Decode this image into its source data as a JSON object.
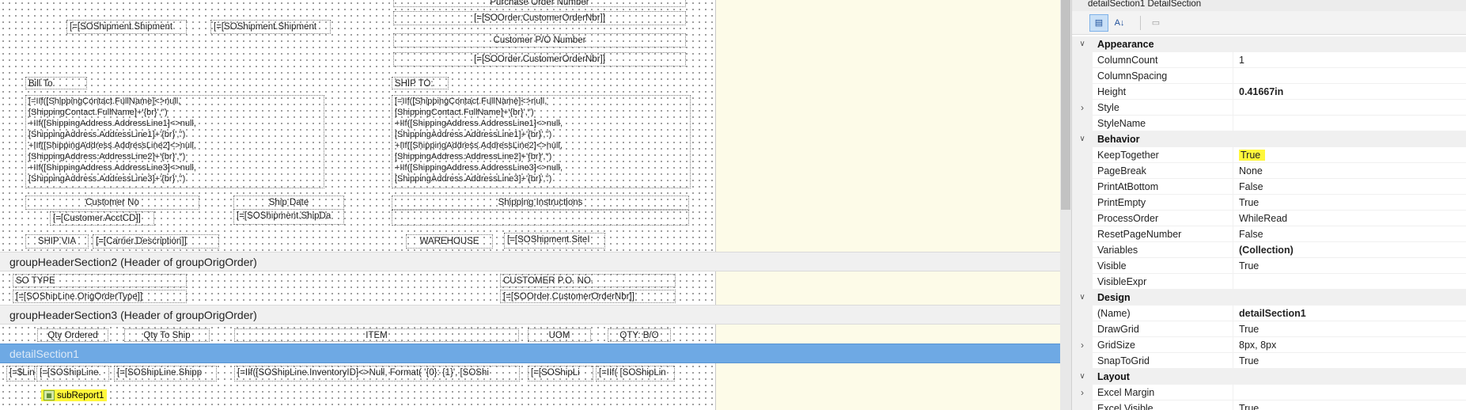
{
  "designer": {
    "page_header": {
      "purchase_order_number": "Purchase Order Number",
      "customer_order_nbr_1": "[=[SOOrder.CustomerOrderNbr]]",
      "customer_po_number": "Customer P/O Number",
      "customer_order_nbr_2": "[=[SOOrder.CustomerOrderNbr]]",
      "shipment_1": "[=[SOShipment.Shipment",
      "shipment_2": "[=[SOShipment.Shipment",
      "bill_to": "Bill To",
      "ship_to": "SHIP TO:",
      "bill_to_expr": "[=IIf([ShippingContact.FullName]<>null,\n[ShippingContact.FullName]+'{br}','')\n+IIf([ShippingAddress.AddressLine1]<>null,\n[ShippingAddress.AddressLine1]+'{br}','')\n+IIf([ShippingAddress.AddressLine2]<>null,\n[ShippingAddress.AddressLine2]+'{br}','')\n+IIf([ShippingAddress.AddressLine3]<>null,\n[ShippingAddress.AddressLine3]+'{br}','')",
      "ship_to_expr": "[=IIf([ShippingContact.FullName]<>null,\n[ShippingContact.FullName]+'{br}','')\n+IIf([ShippingAddress.AddressLine1]<>null,\n[ShippingAddress.AddressLine1]+'{br}','')\n+IIf([ShippingAddress.AddressLine2]<>null,\n[ShippingAddress.AddressLine2]+'{br}','')\n+IIf([ShippingAddress.AddressLine3]<>null,\n[ShippingAddress.AddressLine3]+'{br}','')",
      "customer_no": "Customer No",
      "ship_date": "Ship Date",
      "shipping_instructions": "Shipping Instructions",
      "customer_acctcd": "[=[Customer.AcctCD]]",
      "shipment_shipdate": "[=[SOShipment.ShipDa",
      "ship_via": "SHIP VIA",
      "carrier_description": "[=[Carrier.Description]]",
      "warehouse": "WAREHOUSE",
      "shipment_site": "[=[SOShipment.SiteI"
    },
    "group_header_2": {
      "title": "groupHeaderSection2 (Header of groupOrigOrder)",
      "so_type": "SO TYPE",
      "customer_po_no": "CUSTOMER P.O. NO.",
      "orig_order_type": "[=[SOShipLine.OrigOrderType]]",
      "customer_order_nbr": "[=[SOOrder.CustomerOrderNbr]]"
    },
    "group_header_3": {
      "title": "groupHeaderSection3 (Header of groupOrigOrder)",
      "qty_ordered": "Qty Ordered",
      "qty_to_ship": "Qty To Ship",
      "item": "ITEM",
      "uom": "UOM",
      "qty_bo": "QTY: B/O"
    },
    "detail": {
      "title": "detailSection1",
      "field_1": "[=$Lin",
      "field_2": "[=[SOShipLine.",
      "field_3": "[=[SOShipLine.Shipp",
      "field_4": "[=IIf([SOShipLine.InventoryID]<>Null, Format( '{0}: {1}', [SOShi",
      "field_5": "[=[SOShipLi",
      "field_6": "[=IIf( [SOShipLin",
      "subreport": "subReport1"
    }
  },
  "properties": {
    "header": "detailSection1 DetailSection",
    "toolbar": {
      "categorized_icon": "categorized-icon",
      "alphabetical_icon": "az-sort-icon",
      "pages_icon": "property-pages-icon"
    },
    "rows": [
      {
        "type": "cat",
        "name": "Appearance"
      },
      {
        "type": "prop",
        "name": "ColumnCount",
        "value": "1"
      },
      {
        "type": "prop",
        "name": "ColumnSpacing",
        "value": ""
      },
      {
        "type": "prop",
        "name": "Height",
        "value": "0.41667in",
        "bold": true
      },
      {
        "type": "prop",
        "name": "Style",
        "value": "",
        "expand": true
      },
      {
        "type": "prop",
        "name": "StyleName",
        "value": ""
      },
      {
        "type": "cat",
        "name": "Behavior"
      },
      {
        "type": "prop",
        "name": "KeepTogether",
        "value": "True",
        "highlight": true
      },
      {
        "type": "prop",
        "name": "PageBreak",
        "value": "None"
      },
      {
        "type": "prop",
        "name": "PrintAtBottom",
        "value": "False"
      },
      {
        "type": "prop",
        "name": "PrintEmpty",
        "value": "True"
      },
      {
        "type": "prop",
        "name": "ProcessOrder",
        "value": "WhileRead"
      },
      {
        "type": "prop",
        "name": "ResetPageNumber",
        "value": "False"
      },
      {
        "type": "prop",
        "name": "Variables",
        "value": "(Collection)",
        "bold": true
      },
      {
        "type": "prop",
        "name": "Visible",
        "value": "True"
      },
      {
        "type": "prop",
        "name": "VisibleExpr",
        "value": ""
      },
      {
        "type": "cat",
        "name": "Design"
      },
      {
        "type": "prop",
        "name": "(Name)",
        "value": "detailSection1",
        "bold": true
      },
      {
        "type": "prop",
        "name": "DrawGrid",
        "value": "True"
      },
      {
        "type": "prop",
        "name": "GridSize",
        "value": "8px, 8px",
        "expand": true
      },
      {
        "type": "prop",
        "name": "SnapToGrid",
        "value": "True"
      },
      {
        "type": "cat",
        "name": "Layout"
      },
      {
        "type": "prop",
        "name": "Excel Margin",
        "value": "",
        "expand": true
      },
      {
        "type": "prop",
        "name": "Excel Visible",
        "value": "True"
      }
    ]
  }
}
